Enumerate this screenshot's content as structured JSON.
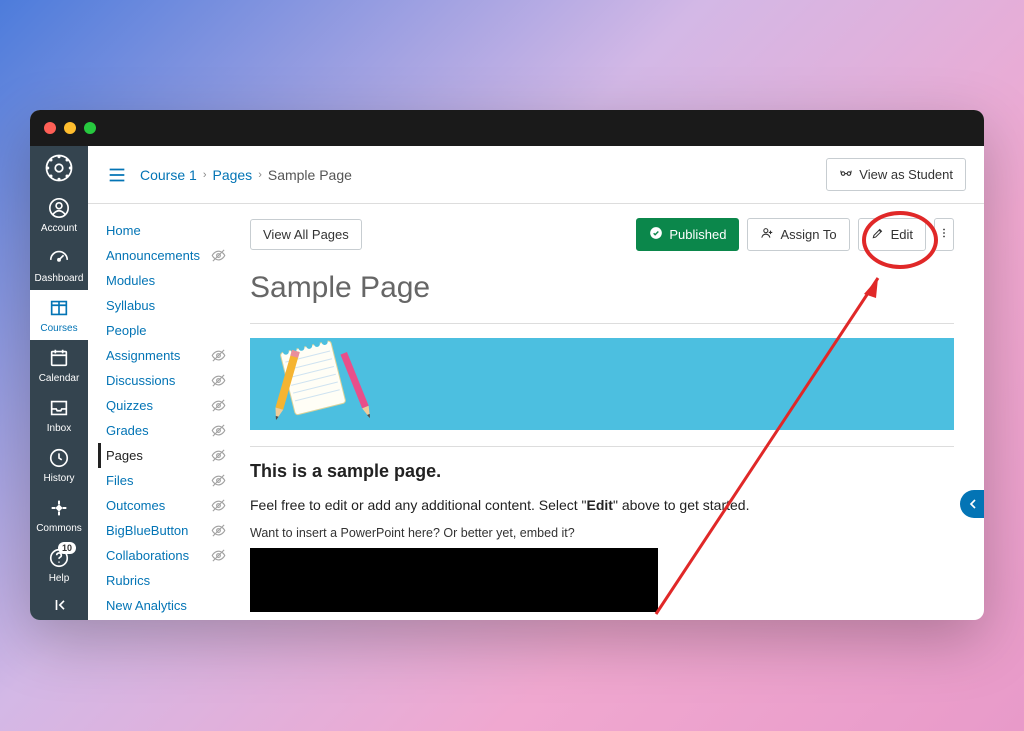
{
  "globalnav": {
    "items": [
      {
        "label": "Account"
      },
      {
        "label": "Dashboard"
      },
      {
        "label": "Courses"
      },
      {
        "label": "Calendar"
      },
      {
        "label": "Inbox"
      },
      {
        "label": "History"
      },
      {
        "label": "Commons"
      },
      {
        "label": "Help"
      }
    ],
    "help_badge": "10"
  },
  "breadcrumb": {
    "course": "Course 1",
    "section": "Pages",
    "page": "Sample Page"
  },
  "topbar": {
    "view_student": "View as Student"
  },
  "coursenav": {
    "items": [
      {
        "label": "Home",
        "hidden": false
      },
      {
        "label": "Announcements",
        "hidden": true
      },
      {
        "label": "Modules",
        "hidden": false
      },
      {
        "label": "Syllabus",
        "hidden": false
      },
      {
        "label": "People",
        "hidden": false
      },
      {
        "label": "Assignments",
        "hidden": true
      },
      {
        "label": "Discussions",
        "hidden": true
      },
      {
        "label": "Quizzes",
        "hidden": true
      },
      {
        "label": "Grades",
        "hidden": true
      },
      {
        "label": "Pages",
        "hidden": true,
        "active": true
      },
      {
        "label": "Files",
        "hidden": true
      },
      {
        "label": "Outcomes",
        "hidden": true
      },
      {
        "label": "BigBlueButton",
        "hidden": true
      },
      {
        "label": "Collaborations",
        "hidden": true
      },
      {
        "label": "Rubrics",
        "hidden": false
      },
      {
        "label": "New Analytics",
        "hidden": false
      }
    ]
  },
  "actions": {
    "view_all": "View All Pages",
    "published": "Published",
    "assign_to": "Assign To",
    "edit": "Edit"
  },
  "page": {
    "title": "Sample Page",
    "heading": "This is a sample page.",
    "body_prefix": "Feel free to edit or add any additional content.  Select \"",
    "body_bold": "Edit",
    "body_suffix": "\" above to get started.",
    "insert_prompt": "Want to insert a PowerPoint here? Or better yet, embed it?"
  }
}
